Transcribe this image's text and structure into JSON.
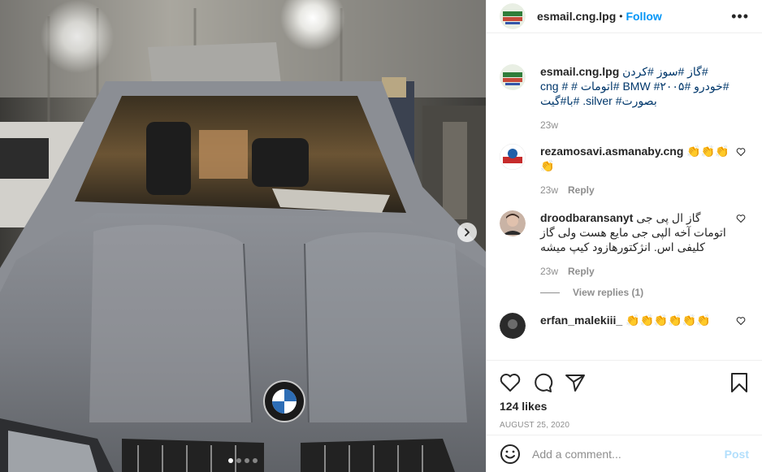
{
  "post": {
    "author": "esmail.cng.lpg",
    "separator": "•",
    "follow_label": "Follow",
    "more_label": "•••",
    "caption_hashtags": "#گاز #سوز #کردن #خودرو #BMW #۲۰۰۵ #اتومات # # cng بصورت# silver. #با#گیت",
    "caption_time": "23w"
  },
  "comments": [
    {
      "username": "rezamosavi.asmanaby.cng",
      "text": "👏👏👏👏",
      "time": "23w",
      "reply_label": "Reply"
    },
    {
      "username": "droodbaransanyt",
      "text": "گاز ال پی جی اتومات آخه الپی جی مایع هست ولی گاز کلیفی اس. انژکتورهازود کیپ میشه",
      "time": "23w",
      "reply_label": "Reply",
      "view_replies": "View replies (1)"
    },
    {
      "username": "erfan_malekiii_",
      "text": "👏👏👏👏👏👏"
    }
  ],
  "stats": {
    "likes": "124 likes",
    "date": "AUGUST 25, 2020"
  },
  "add_comment": {
    "placeholder": "Add a comment...",
    "post_label": "Post"
  },
  "carousel": {
    "slide_count": 4,
    "active_index": 0
  },
  "colors": {
    "link": "#0095f6",
    "muted": "#8e8e8e",
    "post_disabled": "#b2dffc"
  }
}
